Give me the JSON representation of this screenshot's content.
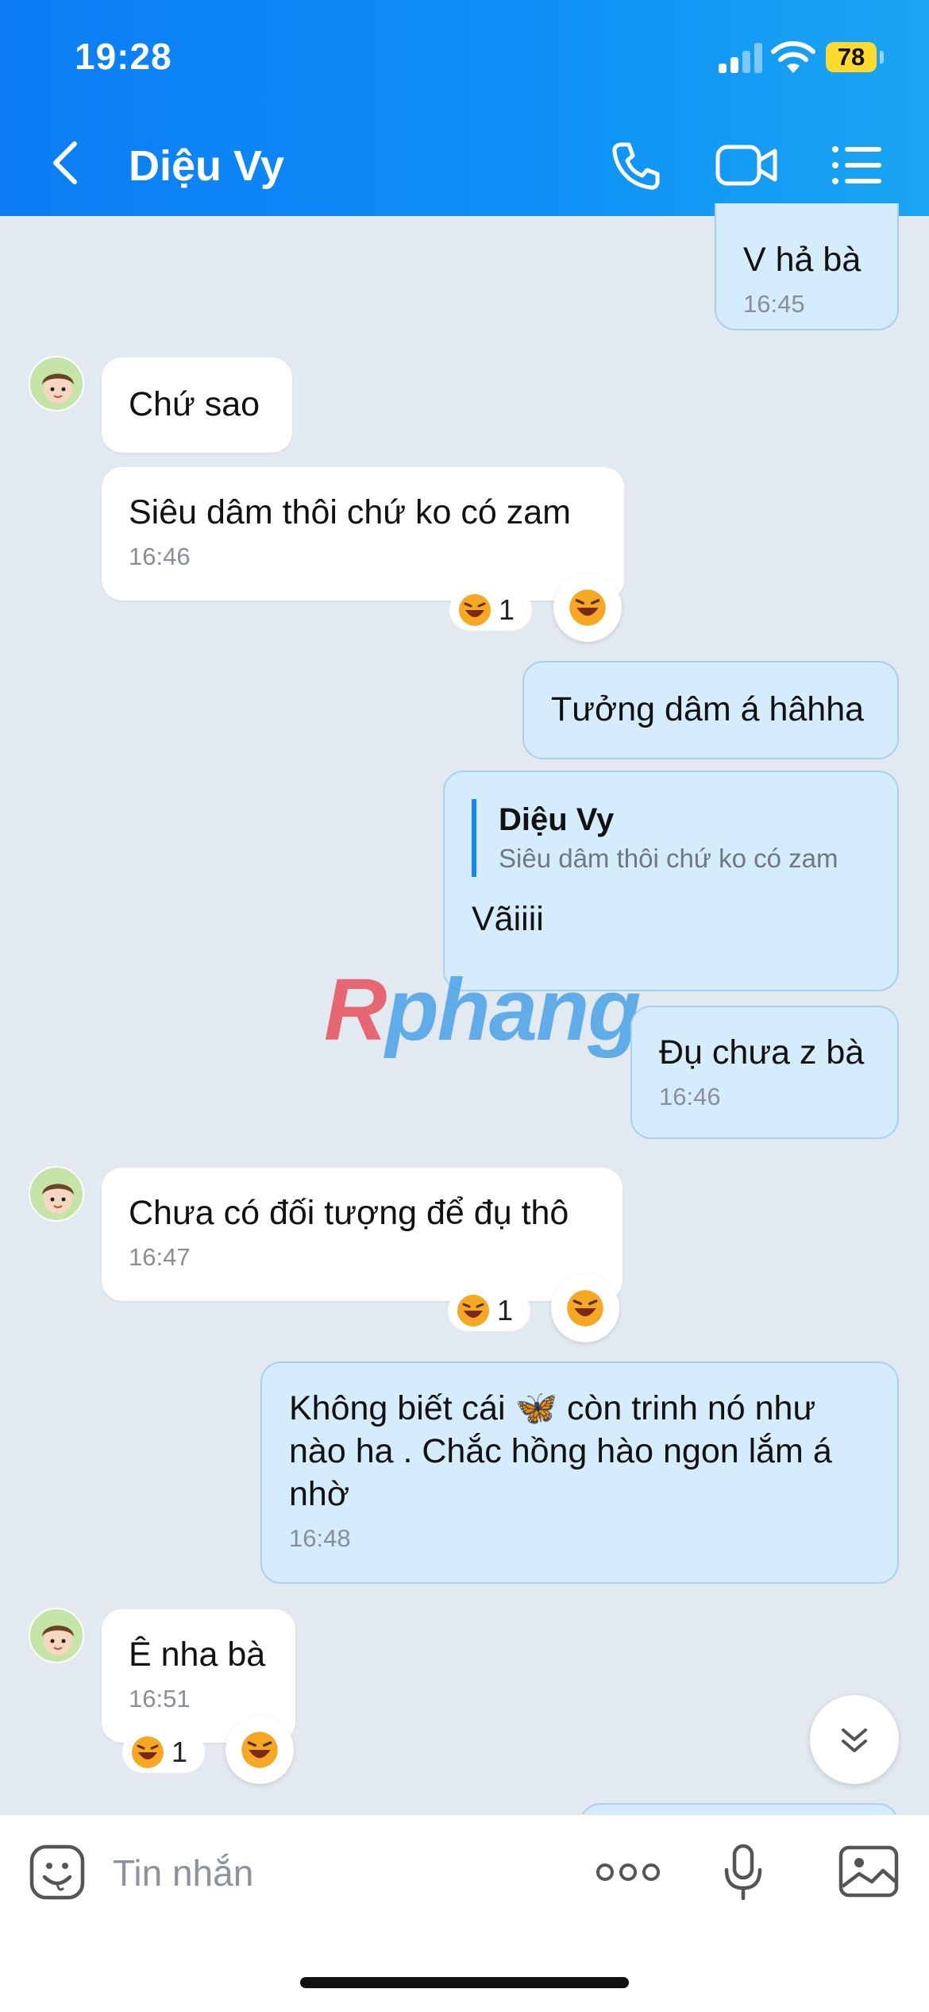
{
  "status_bar": {
    "time": "19:28",
    "battery": "78"
  },
  "header": {
    "title": "Diệu Vy",
    "icons": [
      "back-icon",
      "phone-call-icon",
      "video-call-icon",
      "menu-list-icon"
    ]
  },
  "colors": {
    "header": "#0c7df5",
    "outgoing_bubble": "#d4ecfb",
    "incoming_bubble": "#ffffff",
    "background": "#e2e9f1",
    "reply_bar": "#1686f2"
  },
  "messages": [
    {
      "dir": "out",
      "text": "V hả bà",
      "time": "16:45"
    },
    {
      "dir": "in",
      "text": "Chứ sao"
    },
    {
      "dir": "in",
      "text": "Siêu dâm thôi chứ ko có zam",
      "time": "16:46",
      "reaction_count": "1"
    },
    {
      "dir": "out",
      "text": "Tưởng dâm á hâhha"
    },
    {
      "dir": "out",
      "reply_to": {
        "name": "Diệu Vy",
        "text": "Siêu dâm thôi chứ ko có zam"
      },
      "text": "Vãiiii"
    },
    {
      "dir": "out",
      "text": "Đụ chưa z bà",
      "time": "16:46"
    },
    {
      "dir": "in",
      "text": "Chưa có đối tượng để đụ thô",
      "time": "16:47",
      "reaction_count": "1"
    },
    {
      "dir": "out",
      "text": "Không biết cái 🦋 còn trinh nó như\nnào ha . Chắc hồng hào ngon lắm á\nnhờ",
      "time": "16:48"
    },
    {
      "dir": "in",
      "text": "Ê nha bà",
      "time": "16:51",
      "reaction_count": "1"
    }
  ],
  "watermark": {
    "first": "R",
    "rest": "phang"
  },
  "composer": {
    "placeholder": "Tin nhắn",
    "icons": [
      "sticker-icon",
      "more-icon",
      "microphone-icon",
      "image-icon"
    ]
  }
}
